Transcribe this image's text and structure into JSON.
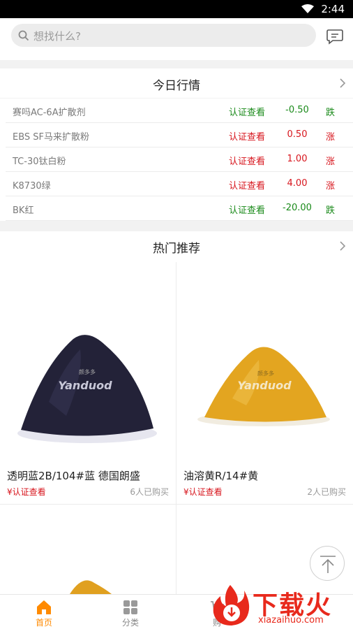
{
  "status_bar": {
    "time": "2:44"
  },
  "search": {
    "placeholder": "想找什么?"
  },
  "market": {
    "title": "今日行情",
    "rows": [
      {
        "name": "赛吗AC-6A扩散剂",
        "cert": "认证查看",
        "value": "-0.50",
        "dir": "跌"
      },
      {
        "name": "EBS SF马来扩散粉",
        "cert": "认证查看",
        "value": "0.50",
        "dir": "涨"
      },
      {
        "name": "TC-30钛白粉",
        "cert": "认证查看",
        "value": "1.00",
        "dir": "涨"
      },
      {
        "name": "K8730绿",
        "cert": "认证查看",
        "value": "4.00",
        "dir": "涨"
      },
      {
        "name": "BK红",
        "cert": "认证查看",
        "value": "-20.00",
        "dir": "跌"
      }
    ]
  },
  "hot": {
    "title": "热门推荐",
    "products": [
      {
        "title": "透明蓝2B/104#蓝 德国朗盛",
        "price": "¥认证查看",
        "sold": "6人已购买",
        "image_label": "Yanduod",
        "image_sub": "颜多多",
        "color": "#232238"
      },
      {
        "title": "油溶黄R/14#黄",
        "price": "¥认证查看",
        "sold": "2人已购买",
        "image_label": "Yanduod",
        "image_sub": "颜多多",
        "color": "#e3a520"
      }
    ]
  },
  "colors": {
    "accent": "#ff8a00",
    "up": "#d7141c",
    "down": "#1a8a1a",
    "watermark": "#e8291c"
  },
  "tabbar": {
    "tabs": [
      {
        "label": "首页",
        "icon": "home-icon",
        "active": true
      },
      {
        "label": "分类",
        "icon": "grid-icon",
        "active": false
      },
      {
        "label": "购",
        "icon": "cart-icon",
        "active": false
      }
    ]
  },
  "watermark": {
    "text": "下载火",
    "domain": "xiazaihuo.com"
  }
}
